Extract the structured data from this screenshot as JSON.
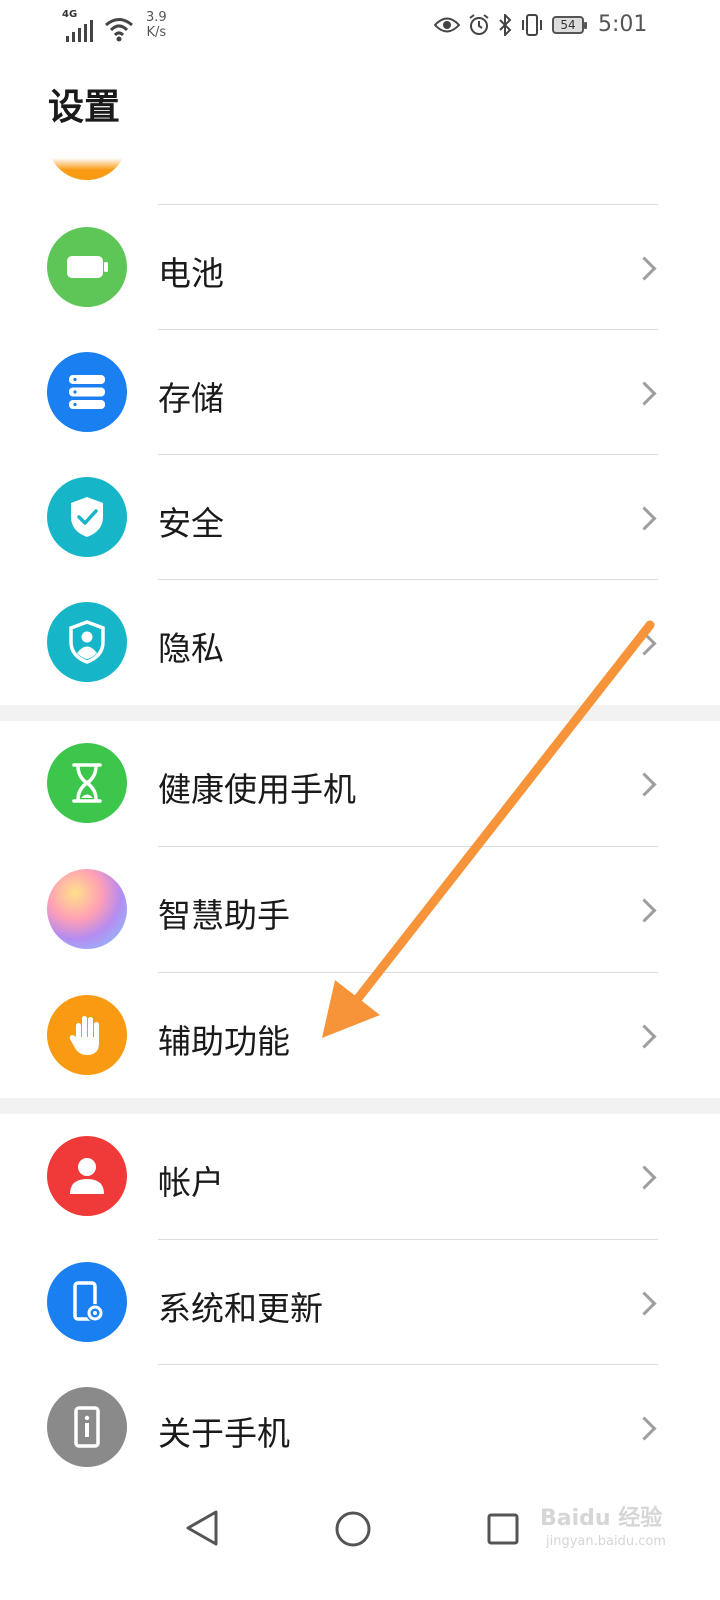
{
  "status": {
    "network": "4G",
    "speed_value": "3.9",
    "speed_unit": "K/s",
    "battery": "54",
    "time": "5:01"
  },
  "page_title": "设置",
  "items": [
    {
      "label": "电池",
      "icon": "battery-icon",
      "color": "#5ec656"
    },
    {
      "label": "存储",
      "icon": "storage-icon",
      "color": "#1a7ff0"
    },
    {
      "label": "安全",
      "icon": "shield-check-icon",
      "color": "#16b6c8"
    },
    {
      "label": "隐私",
      "icon": "privacy-icon",
      "color": "#16b6c8"
    },
    {
      "label": "健康使用手机",
      "icon": "hourglass-icon",
      "color": "#3dc64c"
    },
    {
      "label": "智慧助手",
      "icon": "smart-assistant-icon",
      "color": "#b58cf0"
    },
    {
      "label": "辅助功能",
      "icon": "hand-icon",
      "color": "#f89a12"
    },
    {
      "label": "帐户",
      "icon": "account-icon",
      "color": "#f03a3a"
    },
    {
      "label": "系统和更新",
      "icon": "system-update-icon",
      "color": "#1a7ff0"
    },
    {
      "label": "关于手机",
      "icon": "about-phone-icon",
      "color": "#8a8a8a"
    }
  ],
  "watermark": {
    "text": "Baidu 经验",
    "sub": "jingyan.baidu.com"
  },
  "annotation": {
    "arrow_color": "#f7943a"
  }
}
